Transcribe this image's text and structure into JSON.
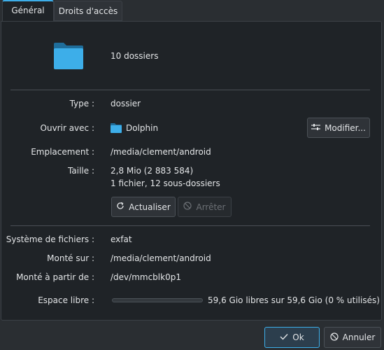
{
  "tabs": [
    {
      "label": "Général",
      "active": true
    },
    {
      "label": "Droits d'accès",
      "active": false
    }
  ],
  "summary": {
    "icon": "folder-icon",
    "text": "10 dossiers"
  },
  "type": {
    "label": "Type :",
    "value": "dossier"
  },
  "open_with": {
    "label": "Ouvrir avec :",
    "app": "Dolphin",
    "app_icon": "folder-icon",
    "button": "Modifier..."
  },
  "location": {
    "label": "Emplacement :",
    "value": "/media/clement/android"
  },
  "size": {
    "label": "Taille :",
    "value": "2,8 Mio (2 883 584)",
    "details": "1 fichier, 12 sous-dossiers",
    "refresh_button": "Actualiser",
    "stop_button": "Arrêter"
  },
  "filesystem": {
    "label": "Système de fichiers :",
    "value": "exfat"
  },
  "mounted_on": {
    "label": "Monté sur :",
    "value": "/media/clement/android"
  },
  "mounted_from": {
    "label": "Monté à partir de :",
    "value": "/dev/mmcblk0p1"
  },
  "free_space": {
    "label": "Espace libre :",
    "value": "59,6 Gio libres sur 59,6 Gio (0 % utilisés)",
    "used_fraction": 0
  },
  "footer": {
    "ok": "Ok",
    "cancel": "Annuler"
  },
  "colors": {
    "accent": "#3daee9",
    "background": "#1f2327",
    "folder": "#3daee9"
  }
}
